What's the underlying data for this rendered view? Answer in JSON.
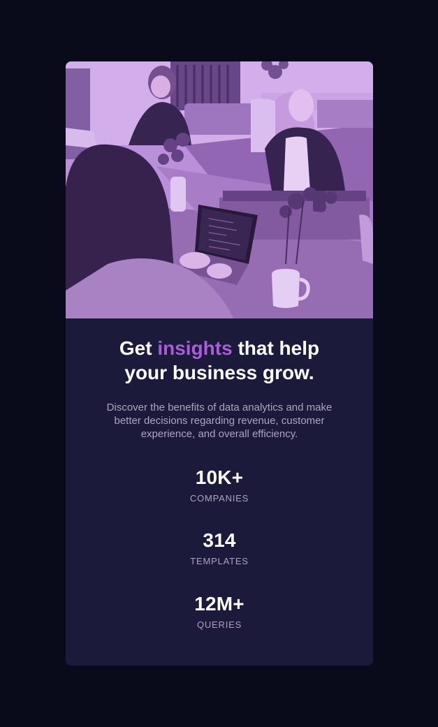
{
  "headline": {
    "before": "Get",
    "accent": "insights",
    "after_line1": "that help",
    "line2": "your business grow."
  },
  "description": "Discover the benefits of data analytics and make better decisions regarding revenue, customer experience, and overall efficiency.",
  "stats": [
    {
      "value": "10K+",
      "label": "COMPANIES"
    },
    {
      "value": "314",
      "label": "TEMPLATES"
    },
    {
      "value": "12M+",
      "label": "QUERIES"
    }
  ],
  "colors": {
    "page_bg": "#090b1a",
    "card_bg": "#1c1a3a",
    "accent": "#ab5cdb",
    "text_main": "#ffffff",
    "text_muted": "#a9a6c0"
  }
}
